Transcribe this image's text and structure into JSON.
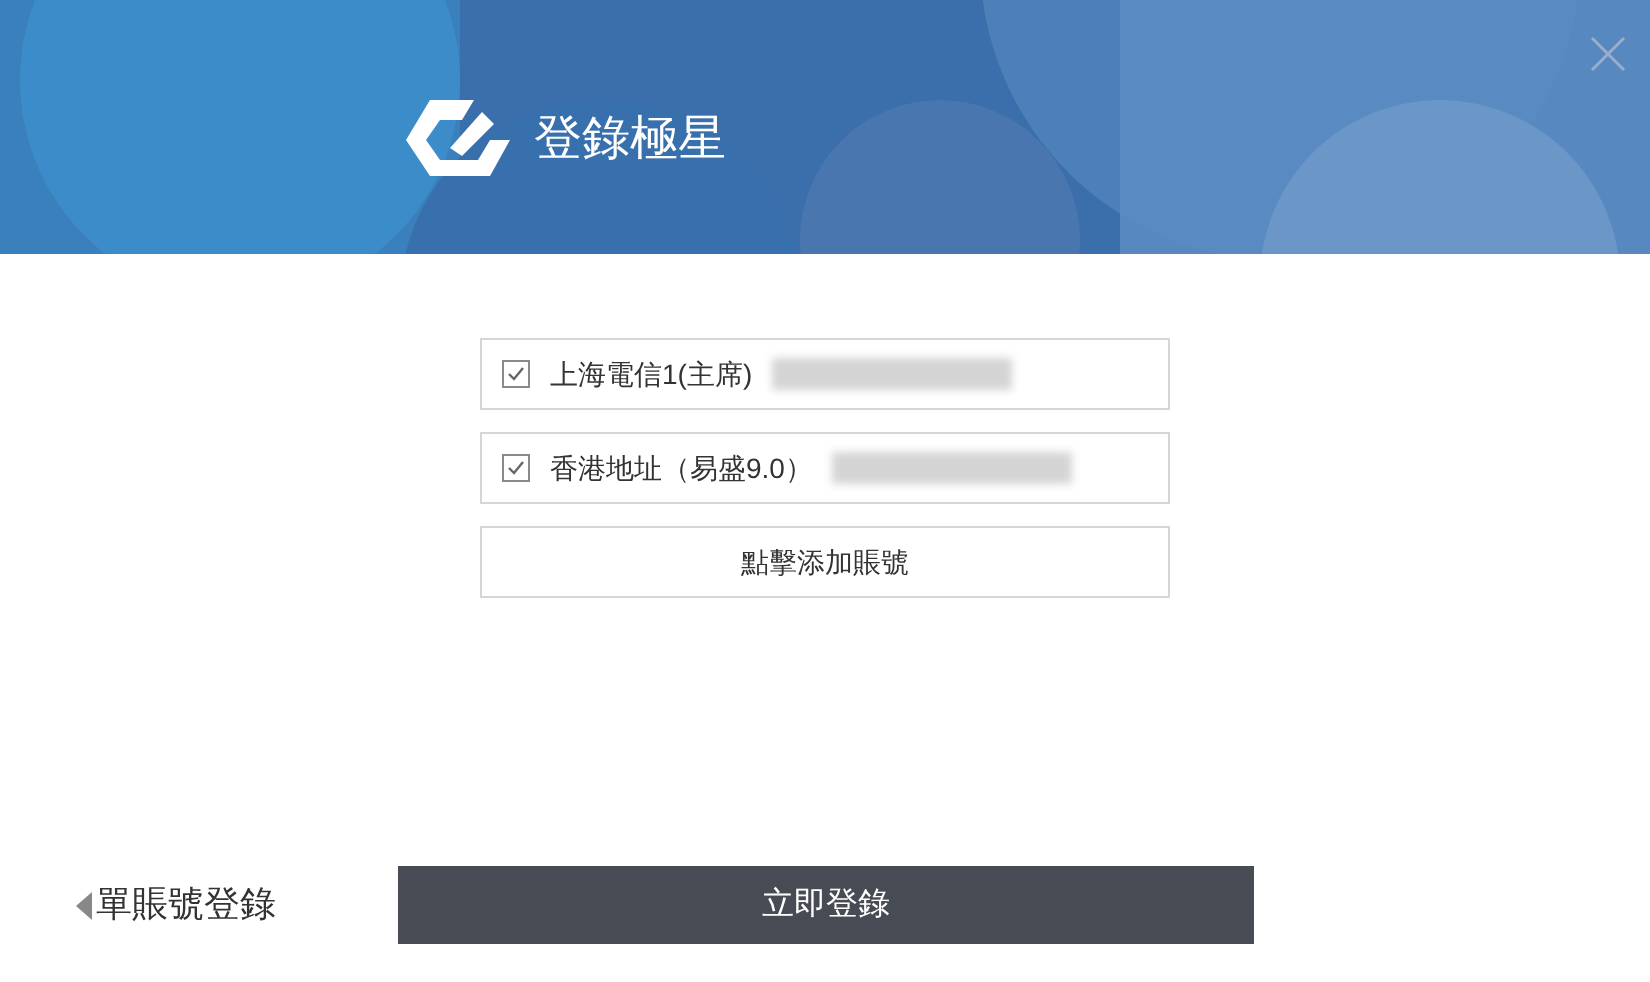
{
  "header": {
    "title": "登錄極星"
  },
  "accounts": [
    {
      "label": "上海電信1(主席)",
      "checked": true,
      "redacted": true
    },
    {
      "label": "香港地址（易盛9.0）",
      "checked": true,
      "redacted": true
    }
  ],
  "add_account": "點擊添加賬號",
  "footer": {
    "back_link": "單賬號登錄",
    "login_button": "立即登錄"
  }
}
